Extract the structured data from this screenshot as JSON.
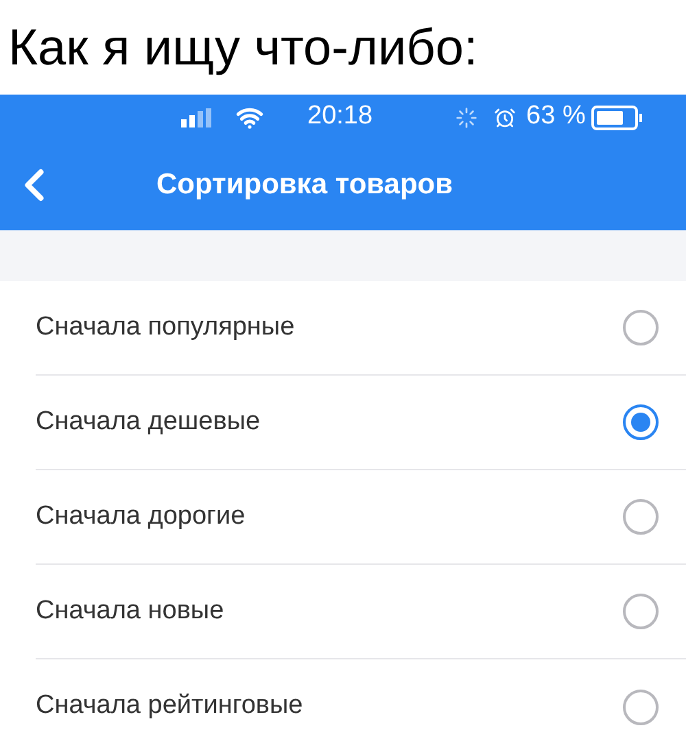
{
  "caption": "Как я ищу что-либо:",
  "status_bar": {
    "time": "20:18",
    "battery": "63 %"
  },
  "header": {
    "title": "Сортировка товаров"
  },
  "options": [
    {
      "label": "Сначала популярные",
      "selected": false
    },
    {
      "label": "Сначала дешевые",
      "selected": true
    },
    {
      "label": "Сначала дорогие",
      "selected": false
    },
    {
      "label": "Сначала новые",
      "selected": false
    },
    {
      "label": "Сначала рейтинговые",
      "selected": false
    }
  ]
}
